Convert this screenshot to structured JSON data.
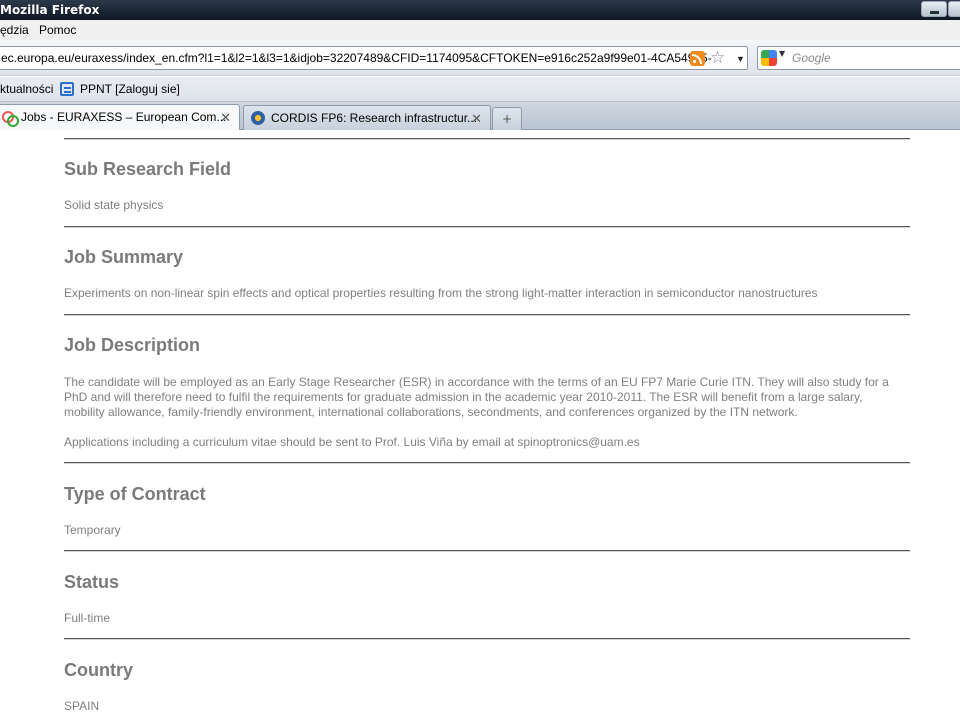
{
  "window": {
    "title": "Mozilla Firefox"
  },
  "menubar": {
    "items": [
      "ędzia",
      "Pomoc"
    ]
  },
  "navbar": {
    "url": "ec.europa.eu/euraxess/index_en.cfm?l1=1&l2=1&l3=1&idjob=32207489&CFID=1174095&CFTOKEN=e916c252a9f99e01-4CA54905-",
    "search_placeholder": "Google"
  },
  "bookmarks": {
    "items": [
      "ktualności",
      "PPNT [Zaloguj sie]"
    ]
  },
  "tabs": [
    {
      "label": "Jobs - EURAXESS – European Com...",
      "active": true
    },
    {
      "label": "CORDIS FP6: Research infrastructur...",
      "active": false
    }
  ],
  "newtab_symbol": "+",
  "sections": {
    "sub_research_field": {
      "heading": "Sub Research Field",
      "text": "Solid state physics"
    },
    "job_summary": {
      "heading": "Job Summary",
      "text": "Experiments on non-linear spin effects and optical properties resulting from the strong light-matter interaction in semiconductor nanostructures"
    },
    "job_description": {
      "heading": "Job Description",
      "text_lines": [
        "The candidate will be employed as an Early Stage Researcher (ESR) in accordance with the terms of an EU FP7 Marie Curie ITN. They will also study for a",
        "PhD and will therefore need to fulfil the requirements for graduate admission in the academic year 2010-2011. The ESR will benefit from a large salary,",
        "mobility allowance, family-friendly environment, international collaborations, secondments, and conferences organized by the ITN network."
      ],
      "text2": "Applications including a curriculum vitae should be sent to Prof. Luis Viña by email at spinoptronics@uam.es"
    },
    "type_of_contract": {
      "heading": "Type of Contract",
      "text": "Temporary"
    },
    "status": {
      "heading": "Status",
      "text": "Full-time"
    },
    "country": {
      "heading": "Country",
      "text": "SPAIN"
    }
  }
}
